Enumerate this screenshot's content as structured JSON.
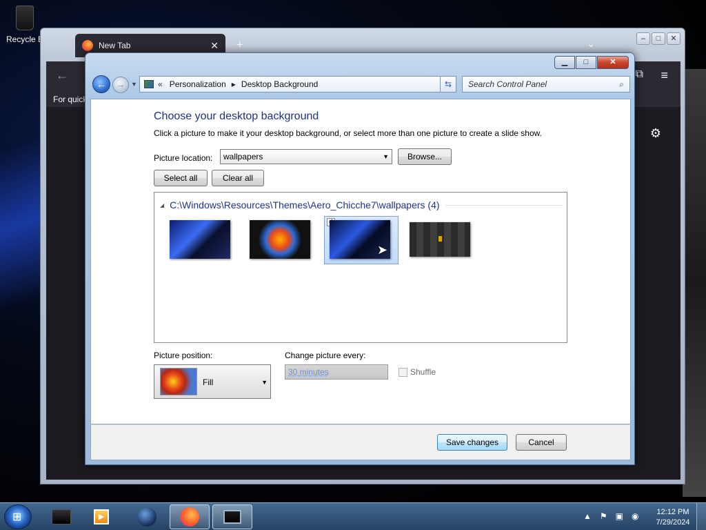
{
  "desktop": {
    "recycle_label": "Recycle B"
  },
  "browser": {
    "tab_title": "New Tab",
    "tab_close": "✕",
    "new_tab_symbol": "+",
    "bookmarks_text": "For quick"
  },
  "window": {
    "breadcrumb_root": "Personalization",
    "breadcrumb_current": "Desktop Background",
    "search_placeholder": "Search Control Panel"
  },
  "content": {
    "heading": "Choose your desktop background",
    "description": "Click a picture to make it your desktop background, or select more than one picture to create a slide show.",
    "picture_location_label": "Picture location:",
    "picture_location_value": "wallpapers",
    "browse_label": "Browse...",
    "select_all_label": "Select all",
    "clear_all_label": "Clear all",
    "group_title": "C:\\Windows\\Resources\\Themes\\Aero_Chicche7\\wallpapers (4)",
    "picture_position_label": "Picture position:",
    "picture_position_value": "Fill",
    "change_picture_label": "Change picture every:",
    "change_picture_value": "30 minutes",
    "shuffle_label": "Shuffle"
  },
  "footer": {
    "save_label": "Save changes",
    "cancel_label": "Cancel"
  },
  "taskbar": {
    "time": "12:12 PM",
    "date": "7/29/2024"
  }
}
